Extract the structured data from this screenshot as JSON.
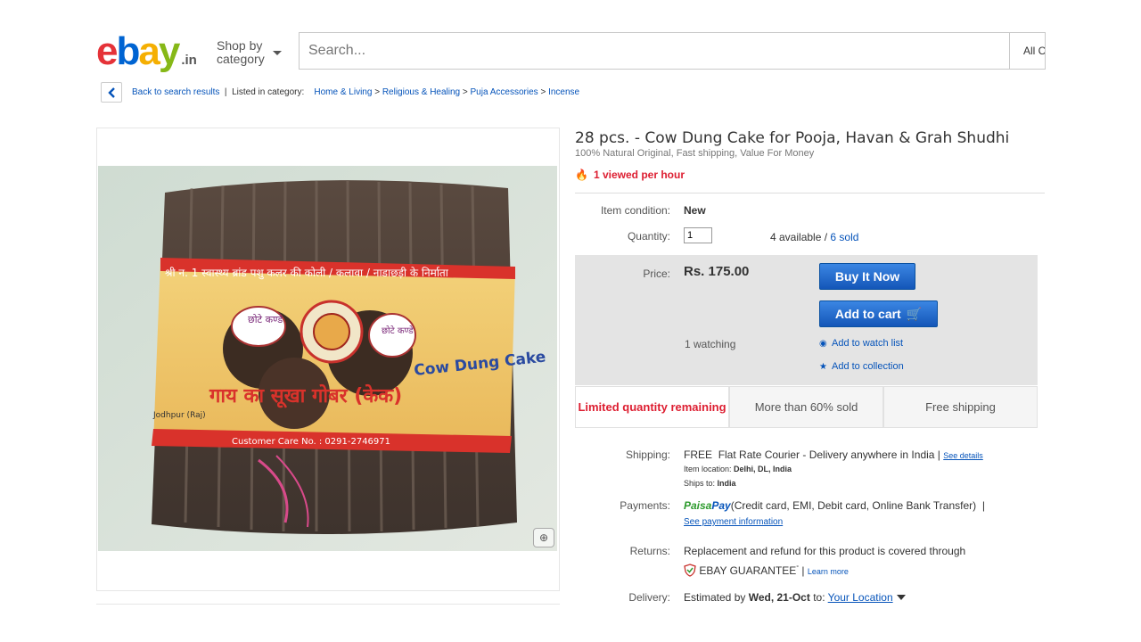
{
  "header": {
    "logo_letters": [
      "e",
      "b",
      "a",
      "y"
    ],
    "logo_suffix": ".in",
    "shop_by_line1": "Shop by",
    "shop_by_line2": "category",
    "search_placeholder": "Search...",
    "all_categories": "All C"
  },
  "breadcrumb": {
    "back": "Back to search results",
    "listed_in": "Listed in category:",
    "items": [
      "Home & Living",
      "Religious & Healing",
      "Puja Accessories",
      "Incense"
    ],
    "separator": ">"
  },
  "product": {
    "title": "28 pcs. - Cow Dung Cake for Pooja, Havan & Grah Shudhi",
    "subtitle": "100% Natural Original, Fast shipping, Value For Money",
    "viewed": "1 viewed per hour",
    "condition_label": "Item condition:",
    "condition_value": "New",
    "quantity_label": "Quantity:",
    "quantity_value": "1",
    "available": "4 available",
    "available_sep": " / ",
    "sold": "6 sold",
    "price_label": "Price:",
    "price": "Rs. 175.00",
    "buy_now": "Buy It Now",
    "add_to_cart": "Add to cart",
    "watching": "1 watching",
    "watch_list": "Add to watch list",
    "collection": "Add to collection"
  },
  "signals": {
    "limited": "Limited quantity remaining",
    "sold_pct": "More than 60% sold",
    "shipping": "Free shipping"
  },
  "details": {
    "shipping_label": "Shipping:",
    "shipping_free": "FREE",
    "shipping_method": "Flat Rate Courier - Delivery anywhere in India",
    "see_details": "See details",
    "item_location_label": "Item location:",
    "item_location": "Delhi, DL, India",
    "ships_to_label": "Ships to:",
    "ships_to": "India",
    "payments_label": "Payments:",
    "paisa_a": "Paisa",
    "paisa_b": "Pay",
    "payments_methods": "(Credit card, EMI, Debit card, Online Bank Transfer)",
    "see_payment": "See payment information",
    "returns_label": "Returns:",
    "returns_text": "Replacement and refund for this product is covered through",
    "guarantee": "EBAY GUARANTEE",
    "learn_more": "Learn more",
    "delivery_label": "Delivery:",
    "estimated_by": "Estimated by",
    "delivery_date": "Wed, 21-Oct",
    "to": "to:",
    "your_location": "Your Location"
  },
  "photo": {
    "package_text_hindi": "गाय का सूखा गोबर (केक)",
    "top_band_text": "श्री न. 1 स्वास्थ्य ब्रांड पशु कलर की कोली / कलावा / नाडाछड़ी के निर्माता",
    "badge_left": "छोटे कण्डे",
    "badge_right": "छोटे कण्डे",
    "label_en": "Cow Dung Cake",
    "customer_care": "Customer Care No. : 0291-2746971",
    "city": "Jodhpur (Raj)"
  },
  "colors": {
    "link": "#0654ba",
    "alert_red": "#dd1e31",
    "button_blue": "#1d63c4",
    "price_box": "#e4e4e4"
  }
}
